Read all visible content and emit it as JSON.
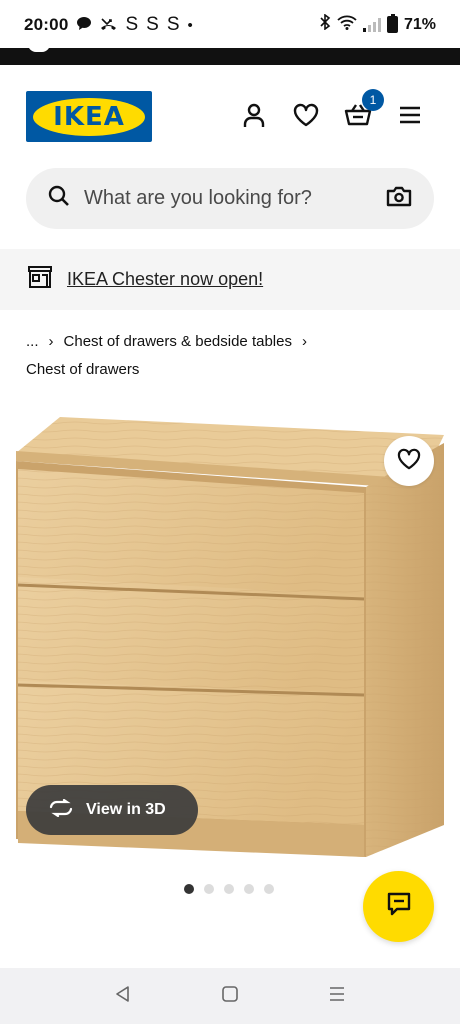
{
  "status_bar": {
    "time": "20:00",
    "notif_icons": [
      "chat-bubble-icon",
      "missed-call-icon"
    ],
    "s_icons": [
      "S",
      "S",
      "S"
    ],
    "more_dot": "•",
    "battery": "71%"
  },
  "header": {
    "logo_text": "IKEA",
    "cart_count": "1",
    "icons": [
      "profile-icon",
      "heart-icon",
      "cart-icon",
      "menu-icon"
    ]
  },
  "search": {
    "placeholder": "What are you looking for?"
  },
  "store_banner": {
    "text": "IKEA Chester now open!"
  },
  "breadcrumb": {
    "ellipsis": "...",
    "separator": "›",
    "parent": "Chest of drawers & bedside tables",
    "current": "Chest of drawers"
  },
  "product": {
    "view3d_label": "View in 3D",
    "image_count": 5,
    "active_image": 1
  },
  "colors": {
    "ikea_blue": "#0058a3",
    "ikea_yellow": "#ffdb00",
    "wood_light": "#e7c896",
    "wood_mid": "#d9b57c",
    "wood_dark": "#c9a26a"
  }
}
